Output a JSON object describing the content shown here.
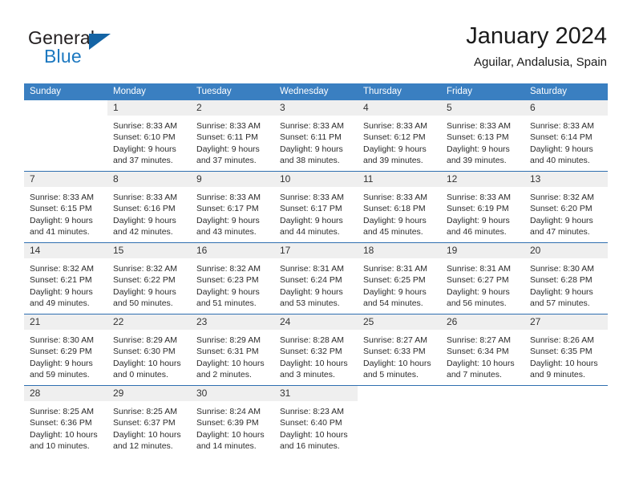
{
  "brand": {
    "name_top": "General",
    "name_bottom": "Blue",
    "logo_icon": "triangle-logo-icon"
  },
  "header": {
    "title": "January 2024",
    "subtitle": "Aguilar, Andalusia, Spain"
  },
  "colors": {
    "header_blue": "#3a7fc1",
    "separator_blue": "#2f6fb0",
    "daynum_band": "#efefef",
    "brand_blue": "#1c78c0",
    "text": "#2b2b2b"
  },
  "weekdays": [
    "Sunday",
    "Monday",
    "Tuesday",
    "Wednesday",
    "Thursday",
    "Friday",
    "Saturday"
  ],
  "weeks": [
    [
      {
        "day": "",
        "blank": true,
        "sunrise": "",
        "sunset": "",
        "daylight1": "",
        "daylight2": ""
      },
      {
        "day": "1",
        "sunrise": "Sunrise: 8:33 AM",
        "sunset": "Sunset: 6:10 PM",
        "daylight1": "Daylight: 9 hours",
        "daylight2": "and 37 minutes."
      },
      {
        "day": "2",
        "sunrise": "Sunrise: 8:33 AM",
        "sunset": "Sunset: 6:11 PM",
        "daylight1": "Daylight: 9 hours",
        "daylight2": "and 37 minutes."
      },
      {
        "day": "3",
        "sunrise": "Sunrise: 8:33 AM",
        "sunset": "Sunset: 6:11 PM",
        "daylight1": "Daylight: 9 hours",
        "daylight2": "and 38 minutes."
      },
      {
        "day": "4",
        "sunrise": "Sunrise: 8:33 AM",
        "sunset": "Sunset: 6:12 PM",
        "daylight1": "Daylight: 9 hours",
        "daylight2": "and 39 minutes."
      },
      {
        "day": "5",
        "sunrise": "Sunrise: 8:33 AM",
        "sunset": "Sunset: 6:13 PM",
        "daylight1": "Daylight: 9 hours",
        "daylight2": "and 39 minutes."
      },
      {
        "day": "6",
        "sunrise": "Sunrise: 8:33 AM",
        "sunset": "Sunset: 6:14 PM",
        "daylight1": "Daylight: 9 hours",
        "daylight2": "and 40 minutes."
      }
    ],
    [
      {
        "day": "7",
        "sunrise": "Sunrise: 8:33 AM",
        "sunset": "Sunset: 6:15 PM",
        "daylight1": "Daylight: 9 hours",
        "daylight2": "and 41 minutes."
      },
      {
        "day": "8",
        "sunrise": "Sunrise: 8:33 AM",
        "sunset": "Sunset: 6:16 PM",
        "daylight1": "Daylight: 9 hours",
        "daylight2": "and 42 minutes."
      },
      {
        "day": "9",
        "sunrise": "Sunrise: 8:33 AM",
        "sunset": "Sunset: 6:17 PM",
        "daylight1": "Daylight: 9 hours",
        "daylight2": "and 43 minutes."
      },
      {
        "day": "10",
        "sunrise": "Sunrise: 8:33 AM",
        "sunset": "Sunset: 6:17 PM",
        "daylight1": "Daylight: 9 hours",
        "daylight2": "and 44 minutes."
      },
      {
        "day": "11",
        "sunrise": "Sunrise: 8:33 AM",
        "sunset": "Sunset: 6:18 PM",
        "daylight1": "Daylight: 9 hours",
        "daylight2": "and 45 minutes."
      },
      {
        "day": "12",
        "sunrise": "Sunrise: 8:33 AM",
        "sunset": "Sunset: 6:19 PM",
        "daylight1": "Daylight: 9 hours",
        "daylight2": "and 46 minutes."
      },
      {
        "day": "13",
        "sunrise": "Sunrise: 8:32 AM",
        "sunset": "Sunset: 6:20 PM",
        "daylight1": "Daylight: 9 hours",
        "daylight2": "and 47 minutes."
      }
    ],
    [
      {
        "day": "14",
        "sunrise": "Sunrise: 8:32 AM",
        "sunset": "Sunset: 6:21 PM",
        "daylight1": "Daylight: 9 hours",
        "daylight2": "and 49 minutes."
      },
      {
        "day": "15",
        "sunrise": "Sunrise: 8:32 AM",
        "sunset": "Sunset: 6:22 PM",
        "daylight1": "Daylight: 9 hours",
        "daylight2": "and 50 minutes."
      },
      {
        "day": "16",
        "sunrise": "Sunrise: 8:32 AM",
        "sunset": "Sunset: 6:23 PM",
        "daylight1": "Daylight: 9 hours",
        "daylight2": "and 51 minutes."
      },
      {
        "day": "17",
        "sunrise": "Sunrise: 8:31 AM",
        "sunset": "Sunset: 6:24 PM",
        "daylight1": "Daylight: 9 hours",
        "daylight2": "and 53 minutes."
      },
      {
        "day": "18",
        "sunrise": "Sunrise: 8:31 AM",
        "sunset": "Sunset: 6:25 PM",
        "daylight1": "Daylight: 9 hours",
        "daylight2": "and 54 minutes."
      },
      {
        "day": "19",
        "sunrise": "Sunrise: 8:31 AM",
        "sunset": "Sunset: 6:27 PM",
        "daylight1": "Daylight: 9 hours",
        "daylight2": "and 56 minutes."
      },
      {
        "day": "20",
        "sunrise": "Sunrise: 8:30 AM",
        "sunset": "Sunset: 6:28 PM",
        "daylight1": "Daylight: 9 hours",
        "daylight2": "and 57 minutes."
      }
    ],
    [
      {
        "day": "21",
        "sunrise": "Sunrise: 8:30 AM",
        "sunset": "Sunset: 6:29 PM",
        "daylight1": "Daylight: 9 hours",
        "daylight2": "and 59 minutes."
      },
      {
        "day": "22",
        "sunrise": "Sunrise: 8:29 AM",
        "sunset": "Sunset: 6:30 PM",
        "daylight1": "Daylight: 10 hours",
        "daylight2": "and 0 minutes."
      },
      {
        "day": "23",
        "sunrise": "Sunrise: 8:29 AM",
        "sunset": "Sunset: 6:31 PM",
        "daylight1": "Daylight: 10 hours",
        "daylight2": "and 2 minutes."
      },
      {
        "day": "24",
        "sunrise": "Sunrise: 8:28 AM",
        "sunset": "Sunset: 6:32 PM",
        "daylight1": "Daylight: 10 hours",
        "daylight2": "and 3 minutes."
      },
      {
        "day": "25",
        "sunrise": "Sunrise: 8:27 AM",
        "sunset": "Sunset: 6:33 PM",
        "daylight1": "Daylight: 10 hours",
        "daylight2": "and 5 minutes."
      },
      {
        "day": "26",
        "sunrise": "Sunrise: 8:27 AM",
        "sunset": "Sunset: 6:34 PM",
        "daylight1": "Daylight: 10 hours",
        "daylight2": "and 7 minutes."
      },
      {
        "day": "27",
        "sunrise": "Sunrise: 8:26 AM",
        "sunset": "Sunset: 6:35 PM",
        "daylight1": "Daylight: 10 hours",
        "daylight2": "and 9 minutes."
      }
    ],
    [
      {
        "day": "28",
        "sunrise": "Sunrise: 8:25 AM",
        "sunset": "Sunset: 6:36 PM",
        "daylight1": "Daylight: 10 hours",
        "daylight2": "and 10 minutes."
      },
      {
        "day": "29",
        "sunrise": "Sunrise: 8:25 AM",
        "sunset": "Sunset: 6:37 PM",
        "daylight1": "Daylight: 10 hours",
        "daylight2": "and 12 minutes."
      },
      {
        "day": "30",
        "sunrise": "Sunrise: 8:24 AM",
        "sunset": "Sunset: 6:39 PM",
        "daylight1": "Daylight: 10 hours",
        "daylight2": "and 14 minutes."
      },
      {
        "day": "31",
        "sunrise": "Sunrise: 8:23 AM",
        "sunset": "Sunset: 6:40 PM",
        "daylight1": "Daylight: 10 hours",
        "daylight2": "and 16 minutes."
      },
      {
        "day": "",
        "blank": true,
        "sunrise": "",
        "sunset": "",
        "daylight1": "",
        "daylight2": ""
      },
      {
        "day": "",
        "blank": true,
        "sunrise": "",
        "sunset": "",
        "daylight1": "",
        "daylight2": ""
      },
      {
        "day": "",
        "blank": true,
        "sunrise": "",
        "sunset": "",
        "daylight1": "",
        "daylight2": ""
      }
    ]
  ]
}
